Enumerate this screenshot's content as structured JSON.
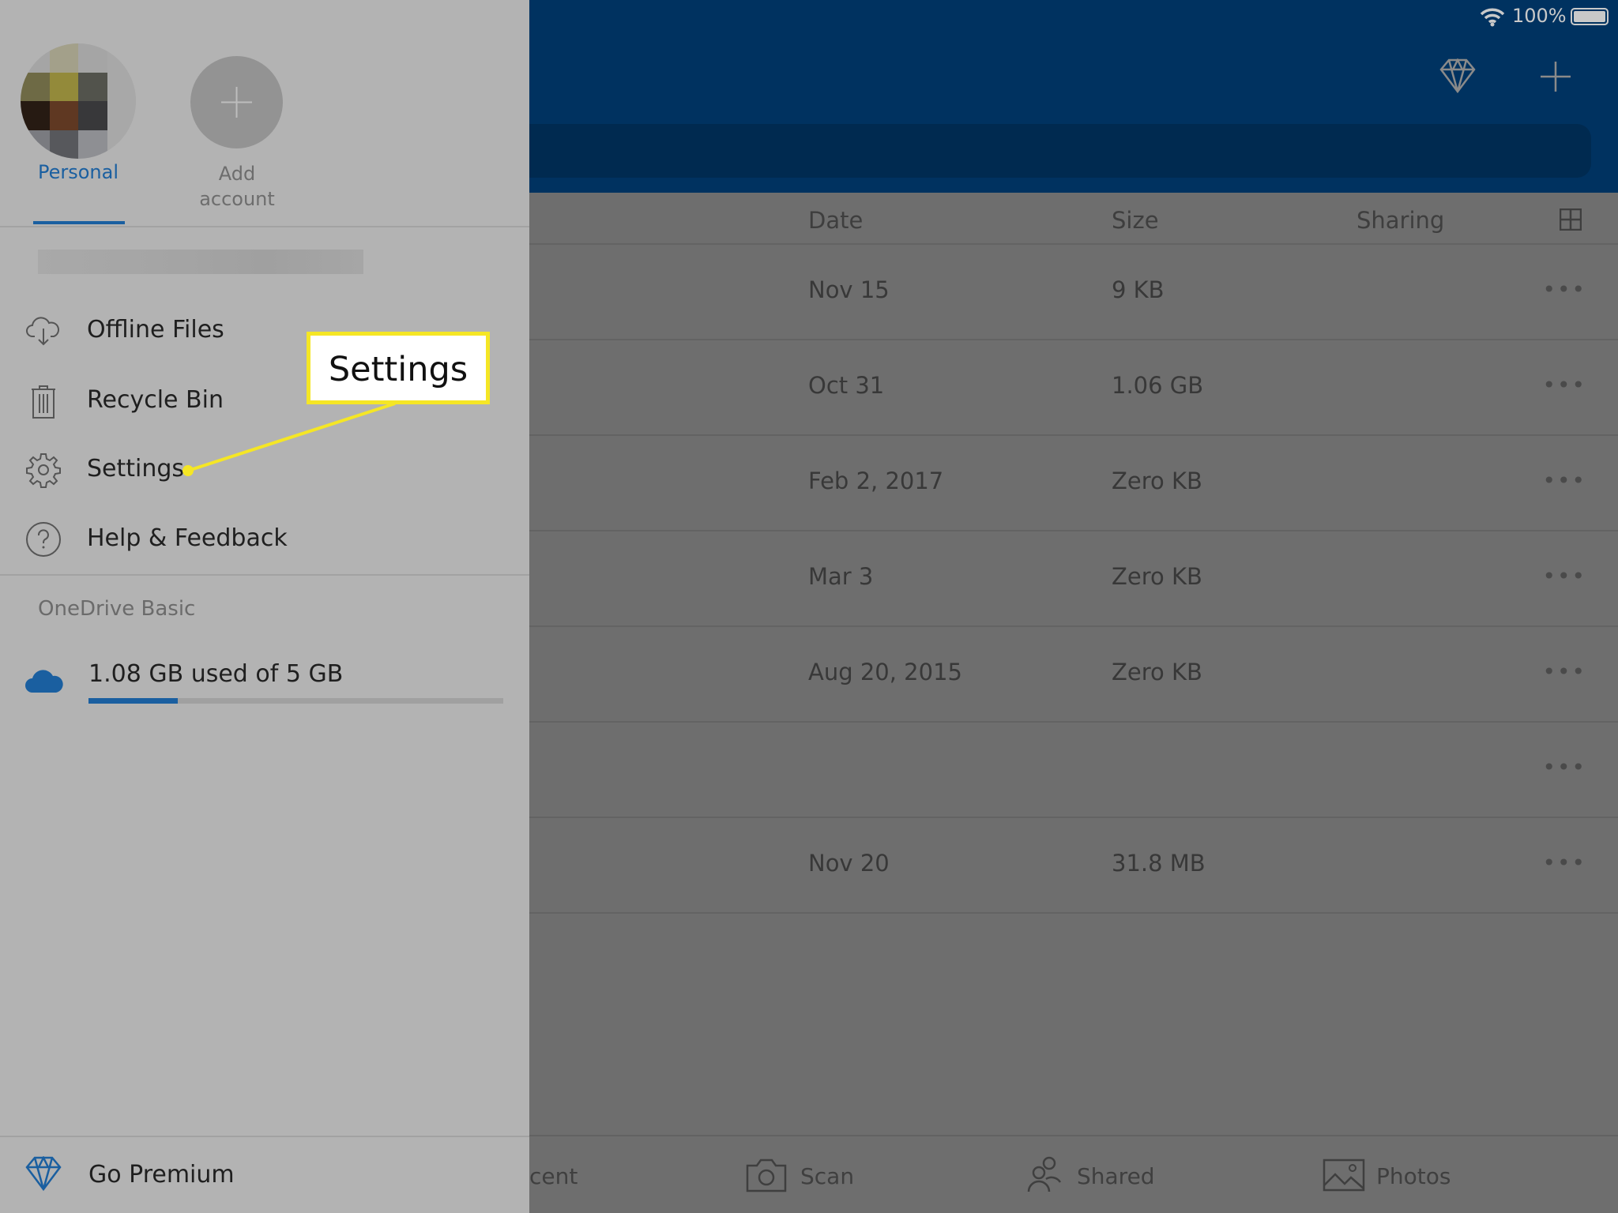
{
  "status": {
    "battery": "100%"
  },
  "columns": {
    "date": "Date",
    "size": "Size",
    "sharing": "Sharing"
  },
  "rows": [
    {
      "date": "Nov 15",
      "size": "9 KB"
    },
    {
      "date": "Oct 31",
      "size": "1.06 GB"
    },
    {
      "date": "Feb 2, 2017",
      "size": "Zero KB"
    },
    {
      "date": "Mar 3",
      "size": "Zero KB"
    },
    {
      "date": "Aug 20, 2015",
      "size": "Zero KB"
    },
    {
      "date": "",
      "size": ""
    },
    {
      "date": "Nov 20",
      "size": "31.8 MB"
    }
  ],
  "more_label": "•••",
  "tabs": {
    "recent": "cent",
    "scan": "Scan",
    "shared": "Shared",
    "photos": "Photos"
  },
  "panel": {
    "accounts": {
      "personal": "Personal",
      "add_line1": "Add",
      "add_line2": "account"
    },
    "menu": [
      "Offline Files",
      "Recycle Bin",
      "Settings",
      "Help & Feedback"
    ],
    "plan": "OneDrive Basic",
    "storage": {
      "text": "1.08 GB used of 5 GB",
      "used_gb": 1.08,
      "total_gb": 5,
      "fraction": 0.216
    },
    "premium": "Go Premium"
  },
  "callout": "Settings",
  "colors": {
    "accent": "#1a5fa0",
    "header": "#003260",
    "callout": "#f5e625"
  }
}
